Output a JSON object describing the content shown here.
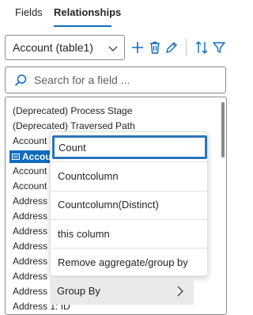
{
  "tabs": [
    {
      "label": "Fields"
    },
    {
      "label": "Relationships"
    }
  ],
  "toolbar": {
    "table_select_value": "Account (table1)",
    "icons": [
      "add-icon",
      "delete-icon",
      "edit-icon",
      "sort-icon",
      "filter-icon"
    ]
  },
  "search": {
    "placeholder": "Search for a field ..."
  },
  "fields": {
    "items": [
      "(Deprecated) Process Stage",
      "(Deprecated) Traversed Path",
      "Account",
      "Accou",
      "Account",
      "Account",
      "Address",
      "Address",
      "Address",
      "Address",
      "Address",
      "Address",
      "Address",
      "Address 1: ID"
    ],
    "selected_index": 3
  },
  "context_menu": {
    "items": [
      {
        "label": "Count"
      },
      {
        "label": "Countcolumn"
      },
      {
        "label": "Countcolumn(Distinct)"
      },
      {
        "label": "this column"
      },
      {
        "label": "Remove aggregate/group by"
      }
    ],
    "group_by_label": "Group By"
  },
  "colors": {
    "accent": "#0f6cbd",
    "focus_border": "#2b74b8"
  }
}
